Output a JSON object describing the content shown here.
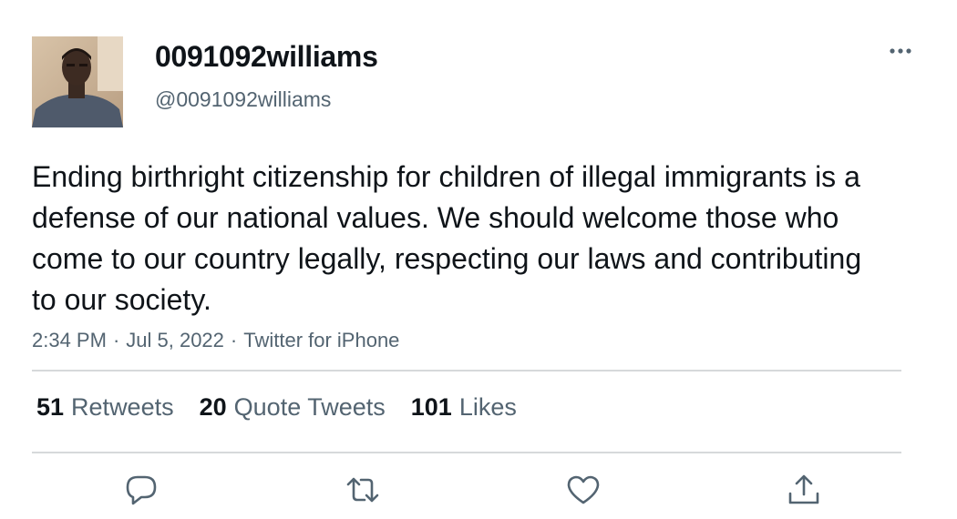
{
  "user": {
    "display_name": "0091092williams",
    "handle": "@0091092williams"
  },
  "tweet": {
    "text": "Ending birthright citizenship for children of illegal immigrants is a defense of our national values. We should welcome those who come to our country legally, respecting our laws and contributing to our society.",
    "time": "2:34 PM",
    "date": "Jul 5, 2022",
    "source": "Twitter for iPhone",
    "separator": "·"
  },
  "stats": {
    "retweets_count": "51",
    "retweets_label": "Retweets",
    "quotes_count": "20",
    "quotes_label": "Quote Tweets",
    "likes_count": "101",
    "likes_label": "Likes"
  },
  "icons": {
    "more": "more-horizontal-icon",
    "reply": "reply-icon",
    "retweet": "retweet-icon",
    "like": "heart-icon",
    "share": "share-icon"
  },
  "colors": {
    "text_primary": "#0f1419",
    "text_secondary": "#536471",
    "divider": "#d6d9db"
  }
}
